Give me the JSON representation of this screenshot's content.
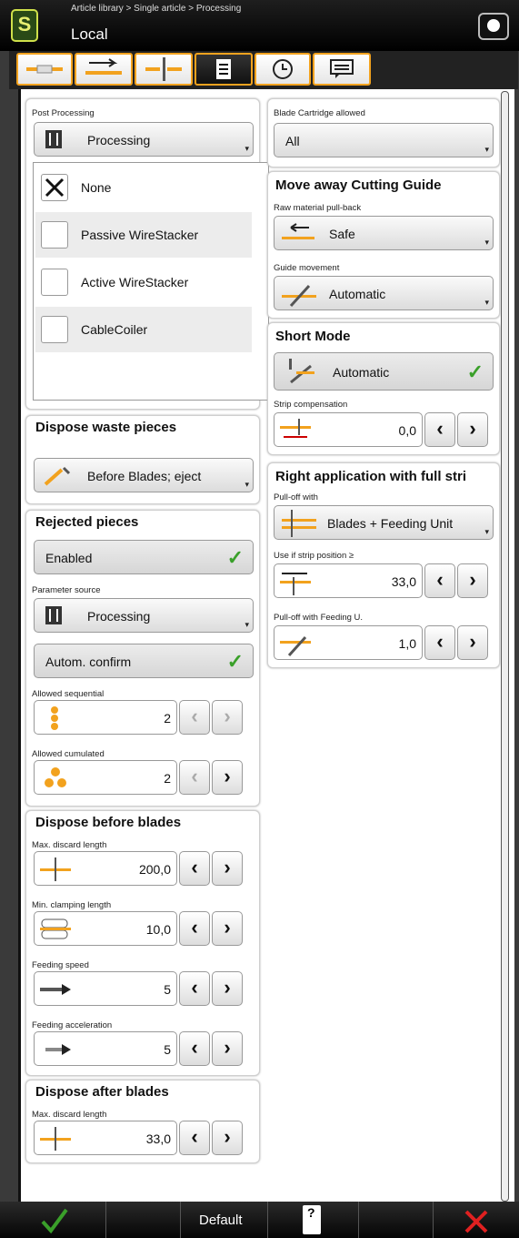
{
  "header": {
    "breadcrumb": "Article library > Single article > Processing",
    "location": "Local",
    "logo": "S"
  },
  "tabs": [
    "cable-icon",
    "feed-icon",
    "cut-icon",
    "list-icon",
    "clock-icon",
    "message-icon"
  ],
  "post_processing": {
    "label": "Post Processing",
    "dropdown": "Processing",
    "items": [
      {
        "label": "None",
        "checked": true
      },
      {
        "label": "Passive WireStacker",
        "checked": false
      },
      {
        "label": "Active WireStacker",
        "checked": false
      },
      {
        "label": "CableCoiler",
        "checked": false
      }
    ]
  },
  "dispose_waste": {
    "heading": "Dispose waste pieces",
    "value": "Before Blades; eject"
  },
  "rejected": {
    "heading": "Rejected pieces",
    "enabled": "Enabled",
    "param_label": "Parameter source",
    "param_value": "Processing",
    "autom": "Autom. confirm",
    "seq_label": "Allowed sequential",
    "seq_value": "2",
    "cum_label": "Allowed cumulated",
    "cum_value": "2"
  },
  "before_blades": {
    "heading": "Dispose before blades",
    "max_label": "Max. discard length",
    "max_value": "200,0",
    "clamp_label": "Min. clamping length",
    "clamp_value": "10,0",
    "speed_label": "Feeding speed",
    "speed_value": "5",
    "accel_label": "Feeding acceleration",
    "accel_value": "5"
  },
  "after_blades": {
    "heading": "Dispose after blades",
    "max_label": "Max. discard length",
    "max_value": "33,0"
  },
  "blade_cartridge": {
    "label": "Blade Cartridge allowed",
    "value": "All"
  },
  "cutting_guide": {
    "heading": "Move away Cutting Guide",
    "pull_label": "Raw material pull-back",
    "pull_value": "Safe",
    "guide_label": "Guide movement",
    "guide_value": "Automatic"
  },
  "short_mode": {
    "heading": "Short Mode",
    "value": "Automatic",
    "strip_label": "Strip compensation",
    "strip_value": "0,0"
  },
  "right_app": {
    "heading": "Right application with full stri",
    "pull_label": "Pull-off with",
    "pull_value": "Blades + Feeding Unit",
    "use_label": "Use if strip position ≥",
    "use_value": "33,0",
    "feed_label": "Pull-off with Feeding U.",
    "feed_value": "1,0"
  },
  "footer": {
    "default_label": "Default",
    "save_label": "?"
  },
  "colors": {
    "accent": "#f2a21e",
    "ok": "#3aa02a",
    "cancel": "#e02020"
  },
  "arrows": {
    "left": "‹",
    "right": "›"
  }
}
